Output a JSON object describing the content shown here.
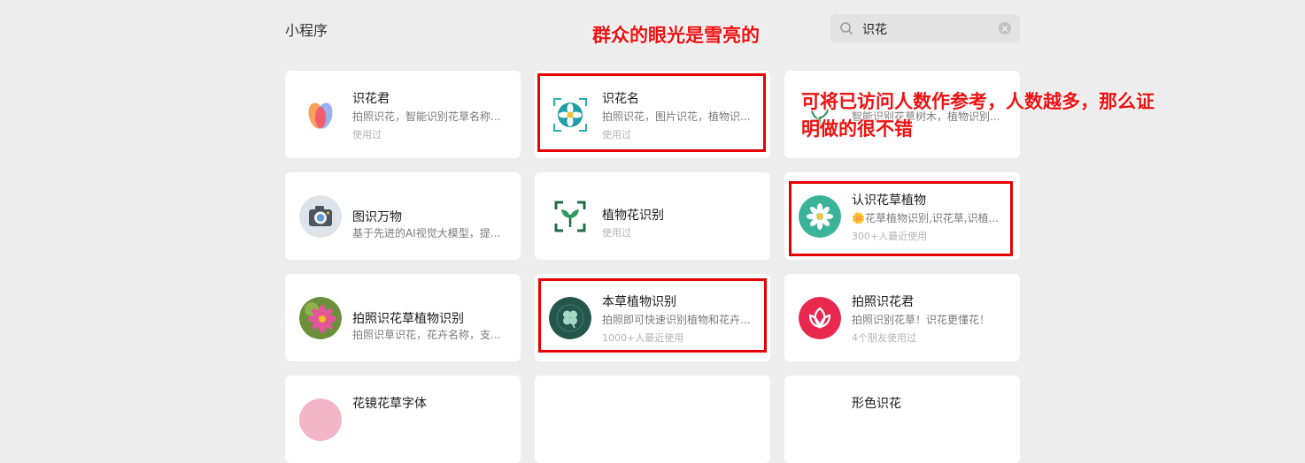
{
  "page": {
    "title": "小程序"
  },
  "search": {
    "query": "识花"
  },
  "annotations": {
    "headline": "群众的眼光是雪亮的",
    "note_line1": "可将已访问人数作参考，人数越多，那么证",
    "note_line2": "明做的很不错"
  },
  "colors": {
    "annotation": "#e60000",
    "background": "#ededed",
    "card": "#ffffff"
  },
  "results": [
    {
      "name": "识花君",
      "desc": "拍照识花，智能识别花草名称...",
      "meta": "使用过",
      "icon": "petal-logo-icon"
    },
    {
      "name": "识花名",
      "desc": "拍照识花，图片识花，植物识...",
      "meta": "使用过",
      "icon": "flower-scan-icon"
    },
    {
      "name": "",
      "desc": "智能识别花草树木，植物识别...",
      "meta": "",
      "icon": "plant-icon"
    },
    {
      "name": "图识万物",
      "desc": "基于先进的AI视觉大模型，提...",
      "meta": "",
      "icon": "camera-icon"
    },
    {
      "name": "植物花识别",
      "desc": "",
      "meta": "使用过",
      "icon": "leaf-scan-icon"
    },
    {
      "name": "认识花草植物",
      "desc": "🌼花草植物识别,识花草,识植...",
      "meta": "300+人最近使用",
      "icon": "daisy-icon"
    },
    {
      "name": "拍照识花草植物识别",
      "desc": "拍照识草识花，花卉名称，支...",
      "meta": "",
      "icon": "pink-flower-photo-icon"
    },
    {
      "name": "本草植物识别",
      "desc": "拍照即可快速识别植物和花卉...",
      "meta": "1000+人最近使用",
      "icon": "clover-icon"
    },
    {
      "name": "拍照识花君",
      "desc": "拍照识别花草！识花更懂花！",
      "meta": "4个朋友使用过",
      "icon": "tulip-logo-icon"
    },
    {
      "name": "花镜花草字体",
      "desc": "",
      "meta": "",
      "icon": "pink-circle-icon"
    },
    {
      "name": "",
      "desc": "",
      "meta": "",
      "icon": ""
    },
    {
      "name": "形色识花",
      "desc": "",
      "meta": "",
      "icon": ""
    }
  ]
}
